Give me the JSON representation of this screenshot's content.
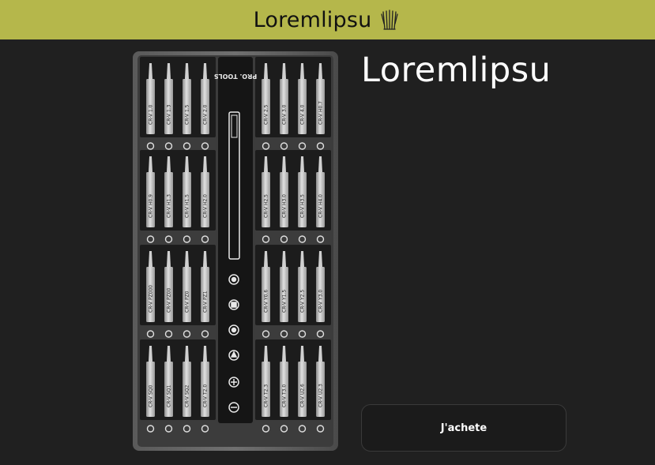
{
  "header": {
    "brand": "Loremlipsu",
    "logo_icon": "brush-icon",
    "background": "#b5b74b"
  },
  "product": {
    "title": "Loremlipsu",
    "image_caption": "PRO. TOOLS",
    "bit_labels": [
      [
        "CR-V 1.0",
        "CR-V 1.3",
        "CR-V 1.5",
        "CR-V 2.0"
      ],
      [
        "CR-V 2.5",
        "CR-V 3.0",
        "CR-V 4.0",
        "CR-V H0.7"
      ],
      [
        "CR-V H0.9",
        "CR-V H1.3",
        "CR-V H1.5",
        "CR-V H2.0"
      ],
      [
        "CR-V H2.5",
        "CR-V H3.0",
        "CR-V H3.5",
        "CR-V H4.0"
      ],
      [
        "CR-V PZ000",
        "CR-V PZ00",
        "CR-V PZ0",
        "CR-V PZ1"
      ],
      [
        "CR-V Y0.6",
        "CR-V Y1.5",
        "CR-V Y2.5",
        "CR-V Y3.0"
      ],
      [
        "CR-V SQ0",
        "CR-V SQ1",
        "CR-V SQ2",
        "CR-V T2.0"
      ],
      [
        "CR-V T2.3",
        "CR-V T3.0",
        "CR-V U2.6",
        "CR-V U2.3"
      ]
    ]
  },
  "actions": {
    "buy_label": "J'achete"
  }
}
